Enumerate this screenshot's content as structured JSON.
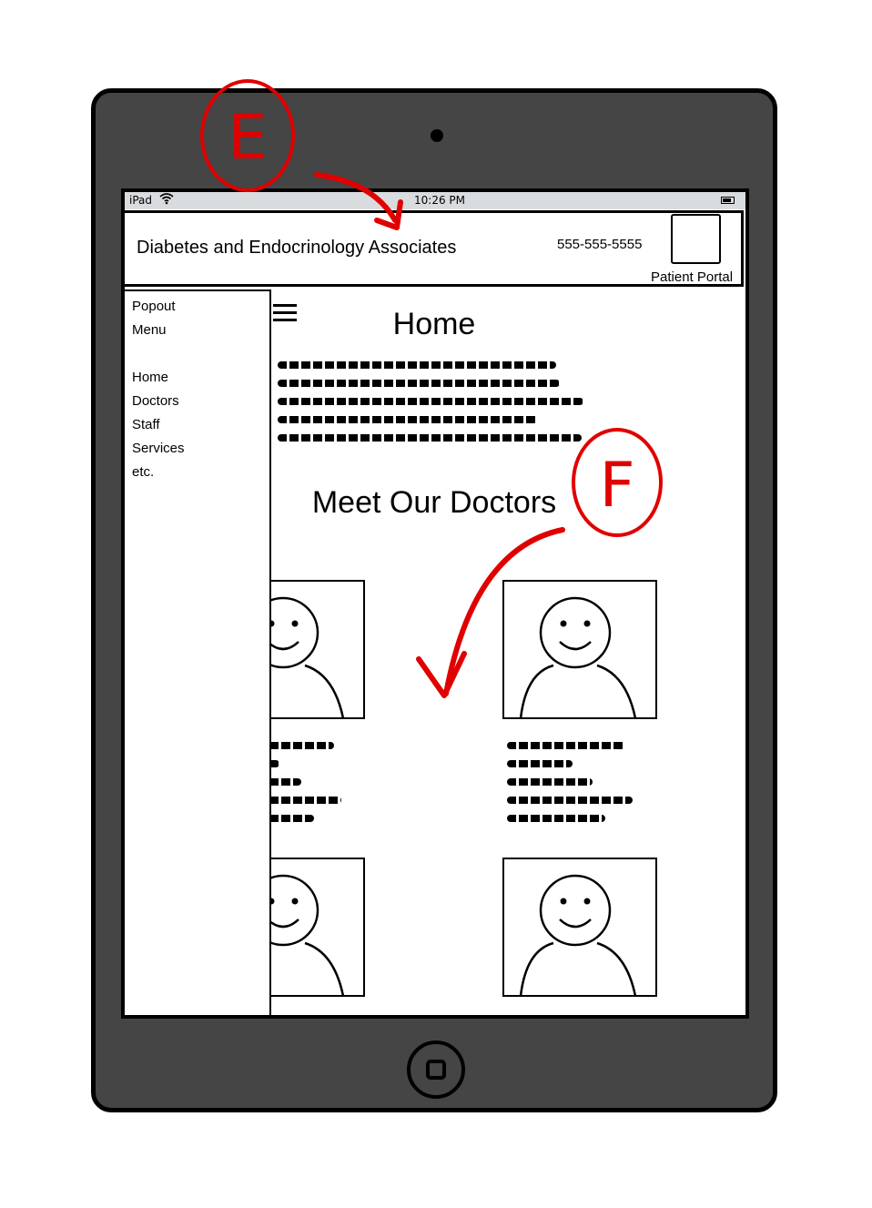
{
  "device": {
    "carrier": "iPad",
    "time": "10:26 PM"
  },
  "header": {
    "site_title": "Diabetes and Endocrinology Associates",
    "phone": "555-555-5555",
    "portal_label": "Patient Portal"
  },
  "main": {
    "page_heading": "Home",
    "section_heading": "Meet Our Doctors"
  },
  "popout_menu": {
    "title": "Popout Menu",
    "items": [
      "Home",
      "Doctors",
      "Staff",
      "Services",
      "etc."
    ]
  },
  "annotations": {
    "label_e": "E",
    "label_f": "F",
    "color": "#e00000"
  }
}
